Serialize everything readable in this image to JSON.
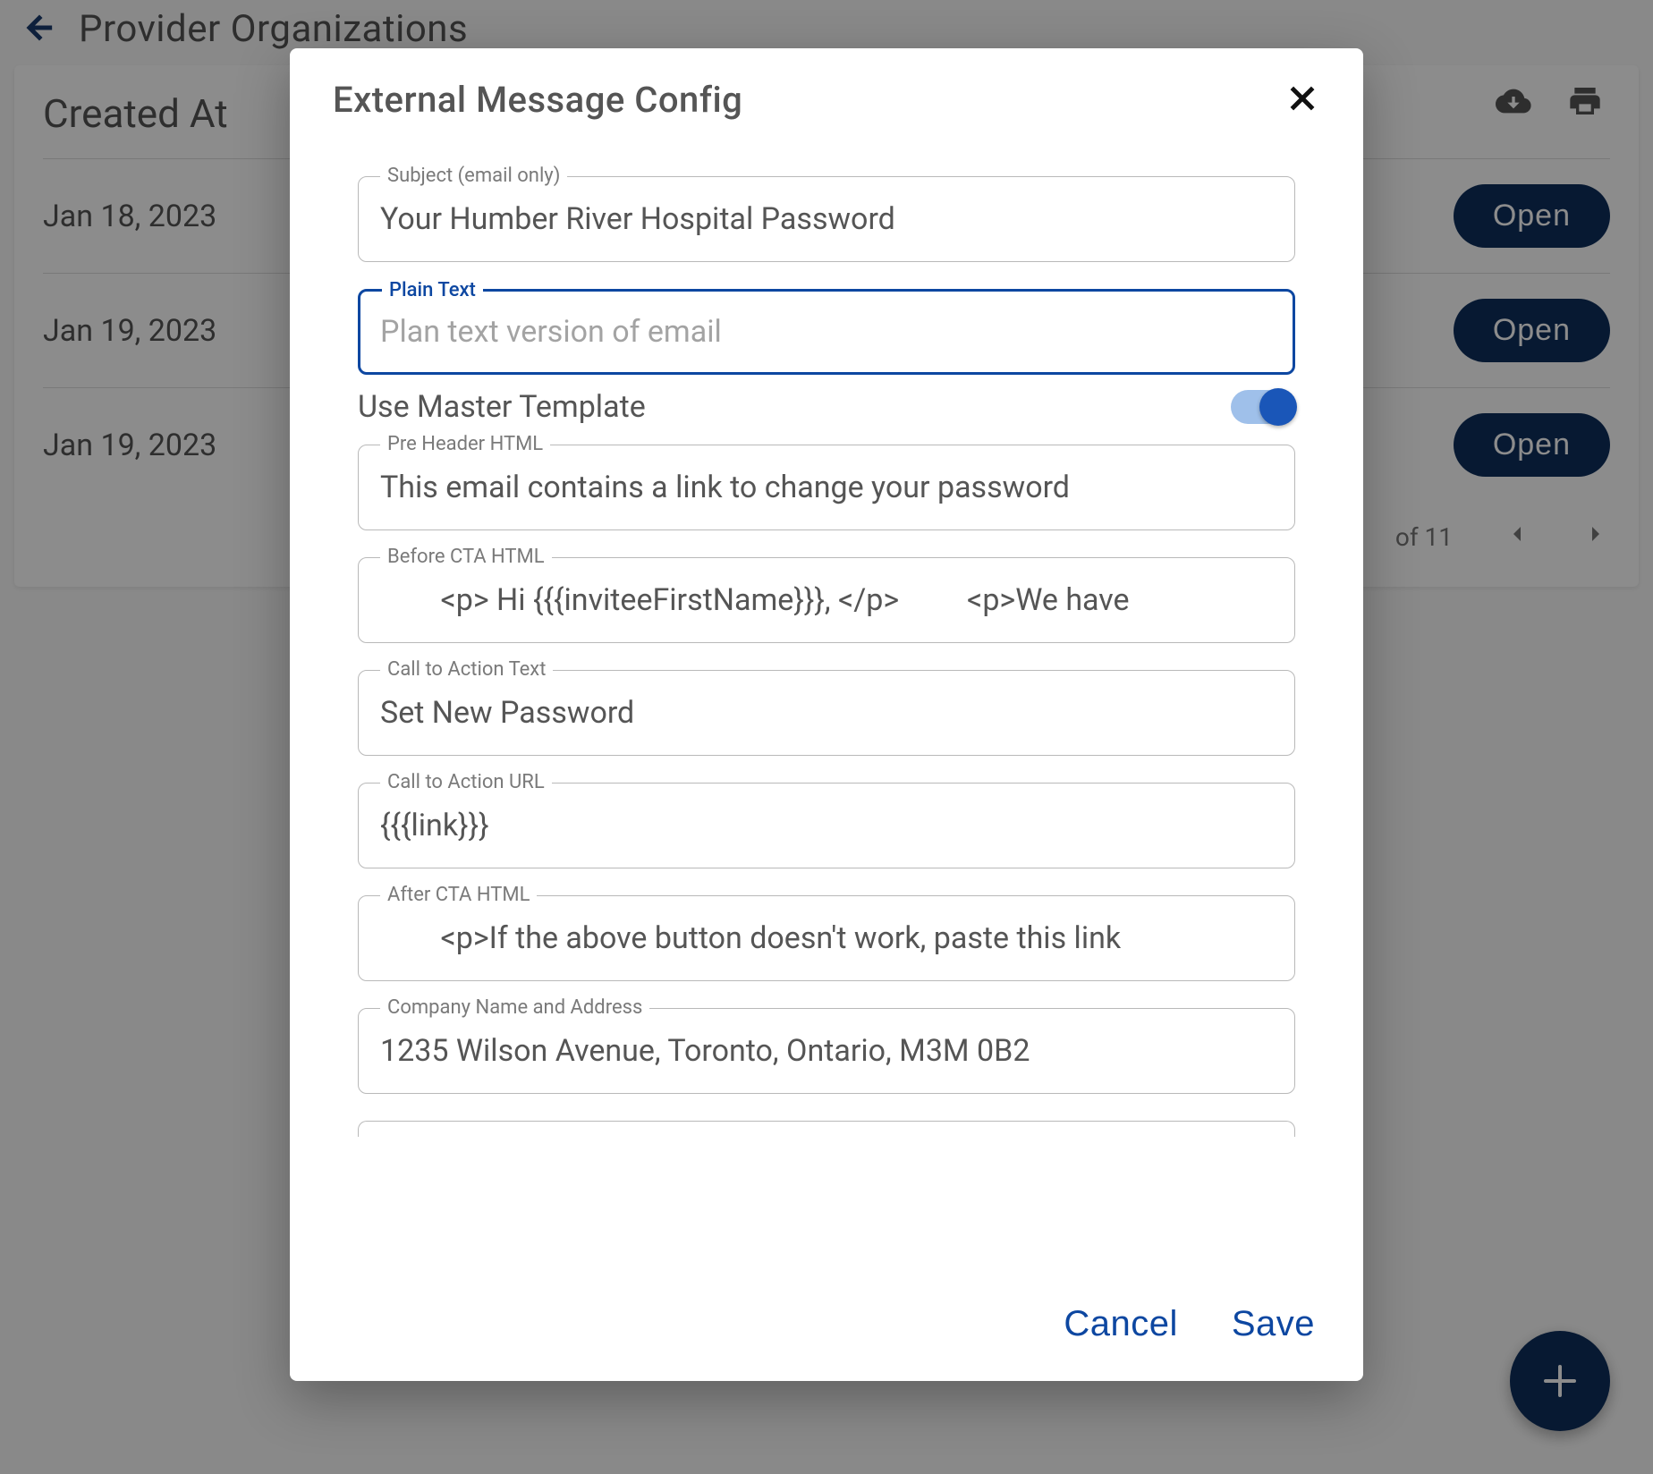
{
  "header": {
    "title": "Provider Organizations"
  },
  "table": {
    "column_header": "Created At",
    "rows": [
      {
        "date": "Jan 18, 2023",
        "action": "Open"
      },
      {
        "date": "Jan 19, 2023",
        "action": "Open"
      },
      {
        "date": "Jan 19, 2023",
        "action": "Open"
      }
    ],
    "pagination": "of 11"
  },
  "dialog": {
    "title": "External Message Config",
    "fields": {
      "subject": {
        "label": "Subject (email only)",
        "value": "Your Humber River Hospital Password"
      },
      "plain_text": {
        "label": "Plain Text",
        "placeholder": "Plan text version of email",
        "value": ""
      },
      "use_master_template": {
        "label": "Use Master Template",
        "enabled": true
      },
      "pre_header": {
        "label": "Pre Header HTML",
        "value": "This email contains a link to change your password"
      },
      "before_cta": {
        "label": "Before CTA HTML",
        "value": "        <p> Hi {{{inviteeFirstName}}}, </p>         <p>We have"
      },
      "cta_text": {
        "label": "Call to Action Text",
        "value": "Set New Password"
      },
      "cta_url": {
        "label": "Call to Action URL",
        "value": "{{{link}}}"
      },
      "after_cta": {
        "label": "After CTA HTML",
        "value": "        <p>If the above button doesn't work, paste this link"
      },
      "company": {
        "label": "Company Name and Address",
        "value": "1235 Wilson Avenue, Toronto, Ontario, M3M 0B2"
      }
    },
    "buttons": {
      "cancel": "Cancel",
      "save": "Save"
    }
  }
}
